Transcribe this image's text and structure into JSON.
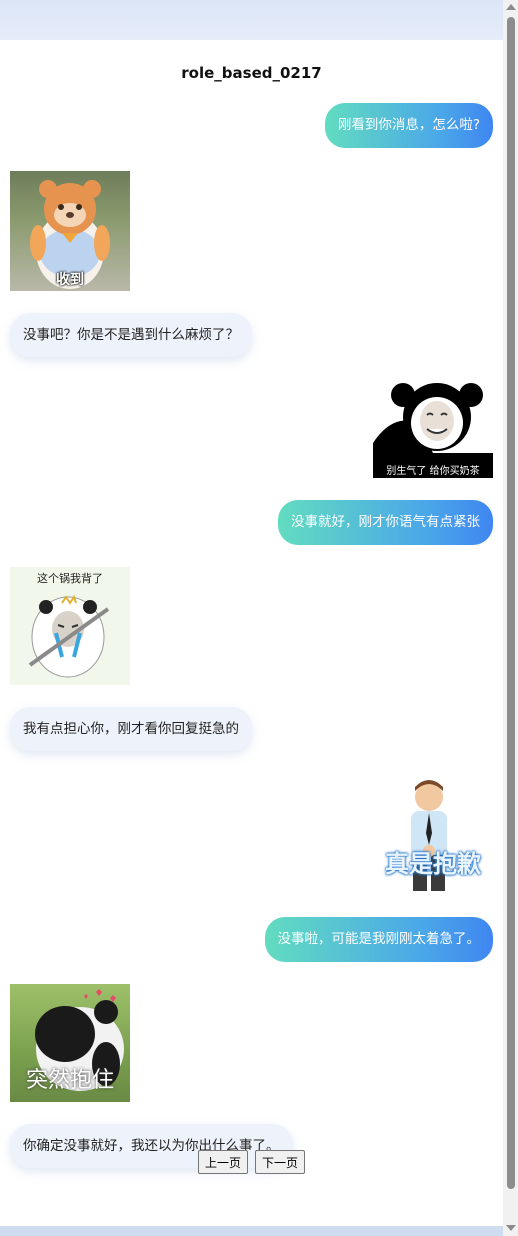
{
  "title": "role_based_0217",
  "messages": [
    {
      "text": "刚看到你消息，怎么啦?"
    },
    {
      "sticker_caption": "收到"
    },
    {
      "text": "没事吧？你是不是遇到什么麻烦了？"
    },
    {
      "sticker_caption": "别生气了 给你买奶茶"
    },
    {
      "text": "没事就好，刚才你语气有点紧张"
    },
    {
      "sticker_caption": "这个锅我背了"
    },
    {
      "text": "我有点担心你，刚才看你回复挺急的"
    },
    {
      "sticker_caption": "真是抱歉"
    },
    {
      "text": "没事啦，可能是我刚刚太着急了。"
    },
    {
      "sticker_caption": "突然抱住"
    },
    {
      "text": "你确定没事就好，我还以为你出什么事了。"
    }
  ],
  "pager": {
    "prev": "上一页",
    "next": "下一页"
  },
  "colors": {
    "user_start": "#62dcc0",
    "user_end": "#3f86f1",
    "bot_bg": "#eef3fb"
  }
}
